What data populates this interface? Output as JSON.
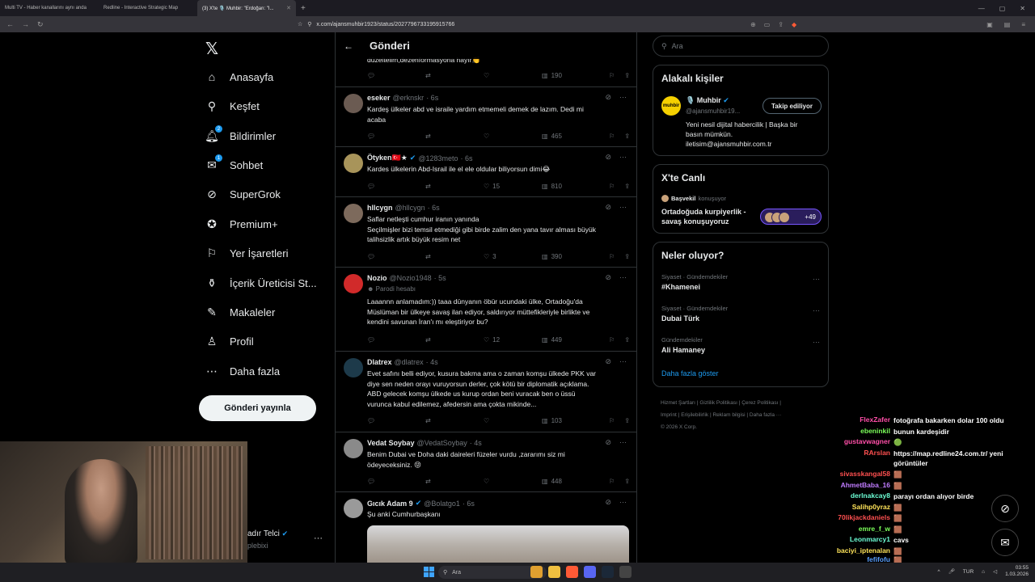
{
  "browser": {
    "tabs": [
      {
        "title": "Multi TV - Haber kanallarını aynı anda"
      },
      {
        "title": "Redline - Interactive Strategic Map"
      },
      {
        "title": "(3) X'te 🎙️ Muhbir: \"Erdoğan: \"I..."
      }
    ],
    "url": "x.com/ajansmuhbir1923/status/2027796733195915766"
  },
  "nav": {
    "items": [
      {
        "label": "Anasayfa",
        "icon": "home-icon"
      },
      {
        "label": "Keşfet",
        "icon": "search-icon"
      },
      {
        "label": "Bildirimler",
        "icon": "bell-icon",
        "badge": "2"
      },
      {
        "label": "Sohbet",
        "icon": "mail-icon",
        "badge": "1"
      },
      {
        "label": "SuperGrok",
        "icon": "grok-icon"
      },
      {
        "label": "Premium+",
        "icon": "premium-icon"
      },
      {
        "label": "Yer İşaretleri",
        "icon": "bookmark-icon"
      },
      {
        "label": "İçerik Üreticisi St...",
        "icon": "creator-icon"
      },
      {
        "label": "Makaleler",
        "icon": "articles-icon"
      },
      {
        "label": "Profil",
        "icon": "profile-icon"
      },
      {
        "label": "Daha fazla",
        "icon": "more-circle-icon"
      }
    ],
    "post_button": "Gönderi yayınla",
    "account_name": "adır Telci",
    "account_handle": "plebixi"
  },
  "main": {
    "header_title": "Gönderi",
    "partial_text": "düzeltelim,dezenformasyona hayır👏",
    "partial_views": "190",
    "tweets": [
      {
        "name": "eseker",
        "handle": "@erknskr",
        "time": "· 6s",
        "text": "Kardeş ülkeler abd ve israile yardım etmemeli demek de lazım. Dedi mi\nacaba",
        "likes": "",
        "views": "465",
        "avatar": "#6b5b52"
      },
      {
        "name": "Ötyken🇹🇷★",
        "handle": "@1283meto",
        "time": "· 6s",
        "text": "Kardes ülkelerin Abd-Israil ile el ele oldular biliyorsun dimi😂",
        "likes": "15",
        "views": "810",
        "verified": true,
        "avatar": "#a8945a"
      },
      {
        "name": "hllcygn",
        "handle": "@hllcygn",
        "time": "· 6s",
        "text": "Saflar netleşti cumhur iranın yanında\nSeçilmişler bizi temsil etmediği gibi birde zalim den yana tavır alması büyük\ntalihsizlik artık büyük resim net",
        "likes": "3",
        "views": "390",
        "avatar": "#7d6a5c"
      },
      {
        "name": "Nozio",
        "handle": "@Nozio1948",
        "time": "· 5s",
        "sub": "Parodi hesabı",
        "text": "Laaannn anlamadım:)) taaa dünyanın öbür ucundaki ülke, Ortadoğu'da\nMüslüman bir ülkeye savaş ilan ediyor, saldırıyor müttefikleriyle birlikte ve\nkendini savunan İran'ı mı eleştiriyor bu?",
        "likes": "12",
        "views": "449",
        "avatar": "#d12a2a"
      },
      {
        "name": "Dlatrex",
        "handle": "@dlatrex",
        "time": "· 4s",
        "text": "Evet safını belli ediyor, kusura bakma ama o zaman komşu ülkede PKK var\ndiye sen neden orayı vuruyorsun derler, çok kötü bir diplomatik açıklama.\nABD gelecek komşu ülkede us kurup ordan beni vuracak ben o üssü\nvurunca kabul edilemez, afedersin ama çokta mikinde...",
        "likes": "",
        "views": "103",
        "avatar": "#1d3a4a"
      },
      {
        "name": "Vedat Soybay",
        "handle": "@VedatSoybay",
        "time": "· 4s",
        "text": "Benim Dubai ve Doha daki daireleri füzeler vurdu ,zararımı siz mi\nödeyeceksiniz. 😝",
        "likes": "",
        "views": "448",
        "avatar": "#8a8a8a"
      },
      {
        "name": "Gıcık Adam 9",
        "handle": "@Bolatgo1",
        "time": "· 6s",
        "text": "Şu anki Cumhurbaşkanı",
        "likes": "",
        "views": "",
        "verified": true,
        "avatar": "#9a9a9a"
      }
    ]
  },
  "right": {
    "search_placeholder": "Ara",
    "related_title": "Alakalı kişiler",
    "related": {
      "name": "🎙️ Muhbir",
      "handle": "@ajansmuhbir19...",
      "logo_text": "muhbir",
      "follow": "Takip ediliyor",
      "bio": "Yeni nesil dijital habercilik | Başka bir\nbasın mümkün.\niletisim@ajansmuhbir.com.tr"
    },
    "live_title": "X'te Canlı",
    "live": {
      "host": "Başvekil",
      "role": "konuşuyor",
      "title": "Ortadoğuda kurpiyerlik - savaş konuşuyoruz",
      "count": "+49"
    },
    "trends_title": "Neler oluyor?",
    "trends": [
      {
        "context": "Siyaset · Gündemdekiler",
        "name": "#Khamenei"
      },
      {
        "context": "Siyaset · Gündemdekiler",
        "name": "Dubai Türk"
      },
      {
        "context": "Gündemdekiler",
        "name": "Ali Hamaney"
      }
    ],
    "show_more": "Daha fazla göster",
    "footer": [
      "Hizmet Şartları",
      "|",
      "Gizlilik Politikası",
      "|",
      "Çerez Politikası",
      "|",
      "Imprint",
      "|",
      "Erişilebilirlik",
      "|",
      "Reklam bilgisi",
      "|",
      "Daha fazla ···",
      "© 2026 X Corp."
    ]
  },
  "chat": [
    {
      "user": "FlexZafer",
      "color": "#ff4fa8",
      "msg": "fotoğrafa bakarken dolar 100 oldu"
    },
    {
      "user": "ebeninkil",
      "color": "#7cff5a",
      "msg": "bunun kardeşidir"
    },
    {
      "user": "gustavwagner",
      "color": "#ff4fa8",
      "msg": "🟢"
    },
    {
      "user": "RArslan",
      "color": "#ff5050",
      "msg": "https://map.redline24.com.tr/ yeni\ngörüntüler"
    },
    {
      "user": "sivasskangal58",
      "color": "#ff5050",
      "msg": "🟫"
    },
    {
      "user": "AhmetBaba_16",
      "color": "#c07cff",
      "msg": "🟫"
    },
    {
      "user": "derlnakcay8",
      "color": "#6dffd6",
      "msg": "parayı ordan alıyor birde"
    },
    {
      "user": "Salihp0yraz",
      "color": "#ffe45a",
      "msg": "🟫"
    },
    {
      "user": "70likjackdaniels",
      "color": "#ff5050",
      "msg": "🟫"
    },
    {
      "user": "emre_f_w",
      "color": "#7cff5a",
      "msg": "🟫"
    },
    {
      "user": "Leonmarcy1",
      "color": "#6dffd6",
      "msg": "cavs"
    },
    {
      "user": "baciyi_iptenalan",
      "color": "#ffe45a",
      "msg": "🟫"
    },
    {
      "user": "fefifofu",
      "color": "#5aa0ff",
      "msg": "🟫"
    }
  ],
  "taskbar": {
    "search": "Ara",
    "lang": "TUR",
    "time": "03:55",
    "date": "1.03.2026"
  }
}
